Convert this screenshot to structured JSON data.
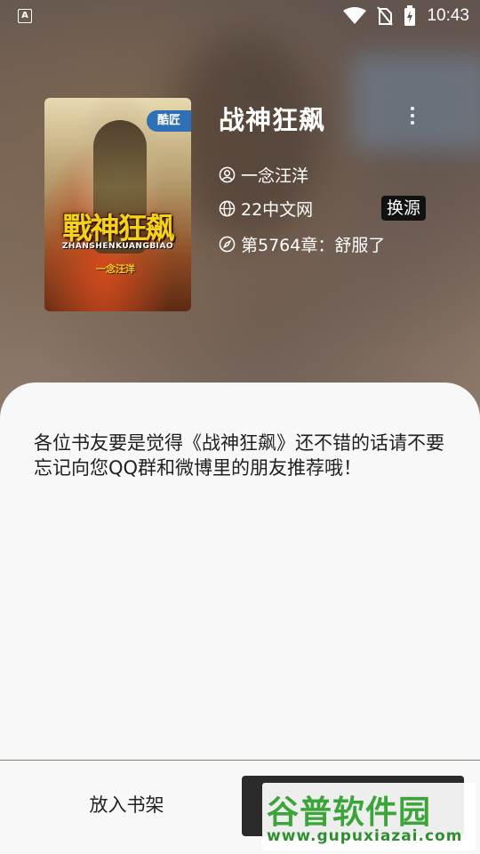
{
  "status_bar": {
    "app_indicator": "A",
    "time": "10:43",
    "icons": [
      "wifi-icon",
      "no-sim-icon",
      "battery-charging-icon"
    ]
  },
  "book": {
    "title": "战神狂飙",
    "author": "一念汪洋",
    "source": "22中文网",
    "change_source_label": "换源",
    "latest_chapter": "第5764章：舒服了",
    "cover": {
      "badge": "酷匠",
      "title": "戰神狂飙",
      "pinyin": "ZHANSHENKUANGBIAO",
      "author": "一念汪洋"
    }
  },
  "intro": "各位书友要是觉得《战神狂飙》还不错的话请不要忘记向您QQ群和微博里的朋友推荐哦！",
  "actions": {
    "add_to_shelf": "放入书架"
  },
  "watermark": {
    "name": "谷普软件园",
    "url": "www.gupuxiazai.com"
  },
  "colors": {
    "sheet_bg": "#f8f8f8",
    "change_source_bg": "#111111",
    "read_button_bg": "#2b2b2b",
    "watermark_green": "#3ca53a"
  }
}
